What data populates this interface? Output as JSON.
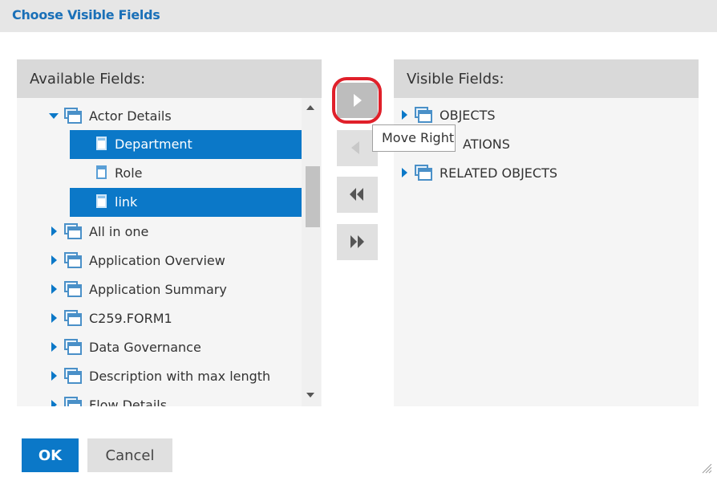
{
  "dialog": {
    "title": "Choose Visible Fields"
  },
  "available": {
    "header": "Available Fields:",
    "items": [
      {
        "label": "Actor Details",
        "type": "folder",
        "expanded": true
      },
      {
        "label": "Department",
        "type": "field",
        "selected": true
      },
      {
        "label": "Role",
        "type": "field",
        "selected": false
      },
      {
        "label": "link",
        "type": "field",
        "selected": true
      },
      {
        "label": "All in one",
        "type": "folder",
        "expanded": false
      },
      {
        "label": "Application Overview",
        "type": "folder",
        "expanded": false
      },
      {
        "label": "Application Summary",
        "type": "folder",
        "expanded": false
      },
      {
        "label": "C259.FORM1",
        "type": "folder",
        "expanded": false
      },
      {
        "label": "Data Governance",
        "type": "folder",
        "expanded": false
      },
      {
        "label": "Description with max length",
        "type": "folder",
        "expanded": false
      },
      {
        "label": "Flow Details",
        "type": "folder",
        "expanded": false
      }
    ]
  },
  "visible": {
    "header": "Visible Fields:",
    "items": [
      {
        "label": "OBJECTS",
        "type": "folder"
      },
      {
        "label": "ATIONS",
        "type": "folder"
      },
      {
        "label": "RELATED OBJECTS",
        "type": "folder"
      }
    ]
  },
  "tooltip": {
    "text": "Move Right"
  },
  "buttons": {
    "ok": "OK",
    "cancel": "Cancel"
  },
  "icons": {
    "move_right": "triangle-right-icon",
    "move_left": "triangle-left-icon",
    "move_all_left": "double-triangle-left-icon",
    "move_all_right": "double-triangle-right-icon"
  },
  "colors": {
    "accent": "#0b78c8",
    "title": "#1a70b8",
    "highlight": "#e0202a"
  }
}
